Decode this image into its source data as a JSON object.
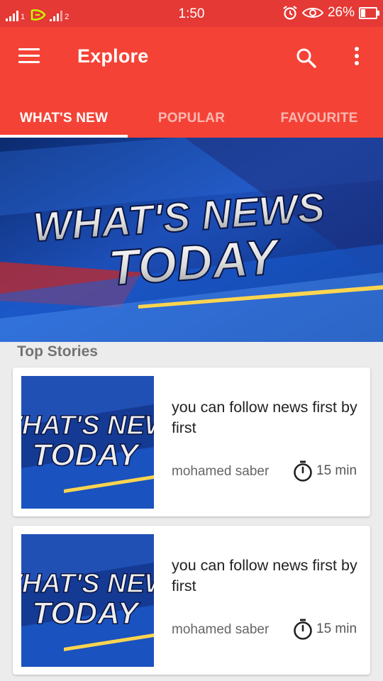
{
  "status_bar": {
    "sim1_label": "1",
    "sim2_label": "2",
    "time": "1:50",
    "battery_percent": "26%",
    "battery_level": 0.26,
    "icons": [
      "signal-icon",
      "carrier-logo-icon",
      "alarm-icon",
      "eye-icon",
      "battery-icon"
    ]
  },
  "app_bar": {
    "title": "Explore",
    "color": "#f44336",
    "icons": [
      "menu-icon",
      "search-icon",
      "more-vert-icon"
    ]
  },
  "tabs": [
    {
      "label": "WHAT'S NEW",
      "active": true
    },
    {
      "label": "POPULAR",
      "active": false
    },
    {
      "label": "FAVOURITE",
      "active": false
    }
  ],
  "hero": {
    "line1": "WHAT'S NEWS",
    "line2": "TODAY"
  },
  "section": {
    "title": "Top Stories"
  },
  "stories": [
    {
      "headline": "you can follow news first by first",
      "author": "mohamed saber",
      "read_time": "15 min",
      "thumb_line1": "WHAT'S NEWS",
      "thumb_line2": "TODAY"
    },
    {
      "headline": "you can follow news first by first",
      "author": "mohamed saber",
      "read_time": "15 min",
      "thumb_line1": "WHAT'S NEWS",
      "thumb_line2": "TODAY"
    }
  ]
}
